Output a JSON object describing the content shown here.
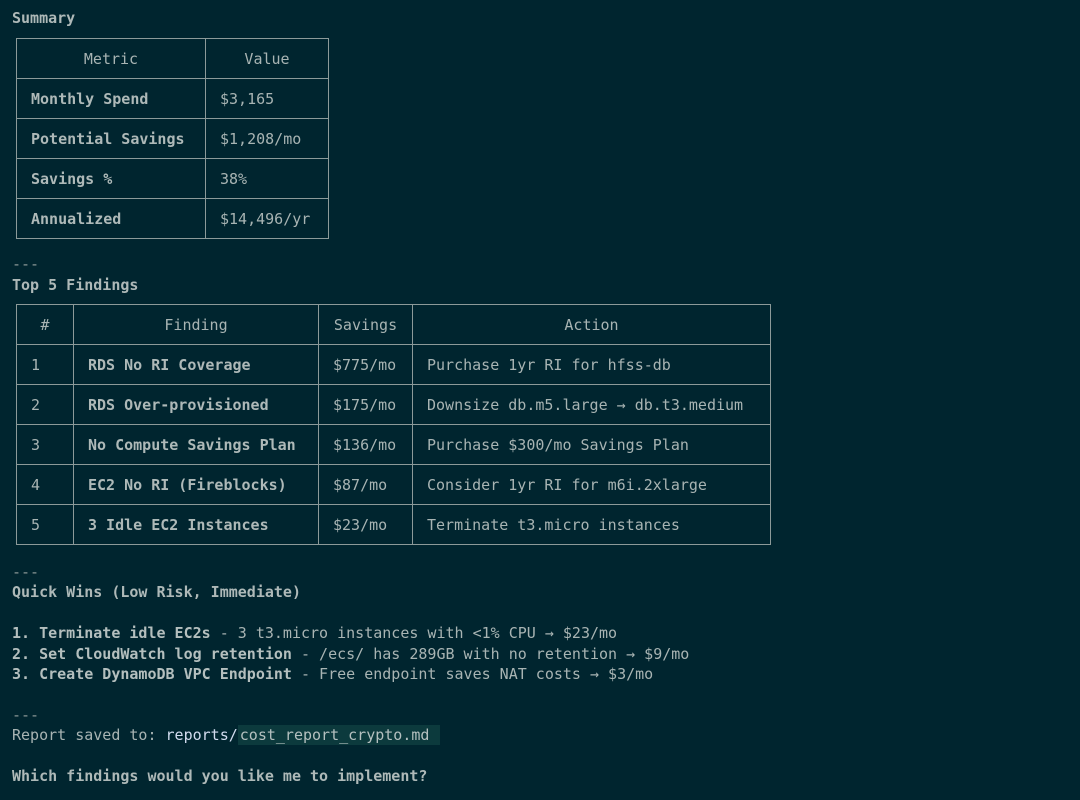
{
  "summary": {
    "heading": "Summary",
    "headers": [
      "Metric",
      "Value"
    ],
    "rows": [
      [
        "Monthly Spend",
        "$3,165"
      ],
      [
        "Potential Savings",
        "$1,208/mo"
      ],
      [
        "Savings %",
        "38%"
      ],
      [
        "Annualized",
        "$14,496/yr"
      ]
    ]
  },
  "separator": "---",
  "findings": {
    "heading": "Top 5 Findings",
    "headers": [
      "#",
      "Finding",
      "Savings",
      "Action"
    ],
    "rows": [
      [
        "1",
        "RDS No RI Coverage",
        "$775/mo",
        "Purchase 1yr RI for hfss-db"
      ],
      [
        "2",
        "RDS Over-provisioned",
        "$175/mo",
        "Downsize db.m5.large → db.t3.medium"
      ],
      [
        "3",
        "No Compute Savings Plan",
        "$136/mo",
        "Purchase $300/mo Savings Plan"
      ],
      [
        "4",
        "EC2 No RI (Fireblocks)",
        "$87/mo",
        "Consider 1yr RI for m6i.2xlarge"
      ],
      [
        "5",
        "3 Idle EC2 Instances",
        "$23/mo",
        "Terminate t3.micro instances"
      ]
    ]
  },
  "quick_wins": {
    "heading": "Quick Wins (Low Risk, Immediate)",
    "items": [
      {
        "num": "1.",
        "title": "Terminate idle EC2s",
        "text": " - 3 t3.micro instances with <1% CPU → $23/mo"
      },
      {
        "num": "2.",
        "title": "Set CloudWatch log retention",
        "text": " - /ecs/ has 289GB with no retention → $9/mo"
      },
      {
        "num": "3.",
        "title": "Create DynamoDB VPC Endpoint",
        "text": " - Free endpoint saves NAT costs → $3/mo"
      }
    ]
  },
  "report": {
    "prefix": "Report saved to: ",
    "dir": "reports/",
    "file": "cost_report_crypto.md "
  },
  "question": "Which findings would you like me to implement?"
}
